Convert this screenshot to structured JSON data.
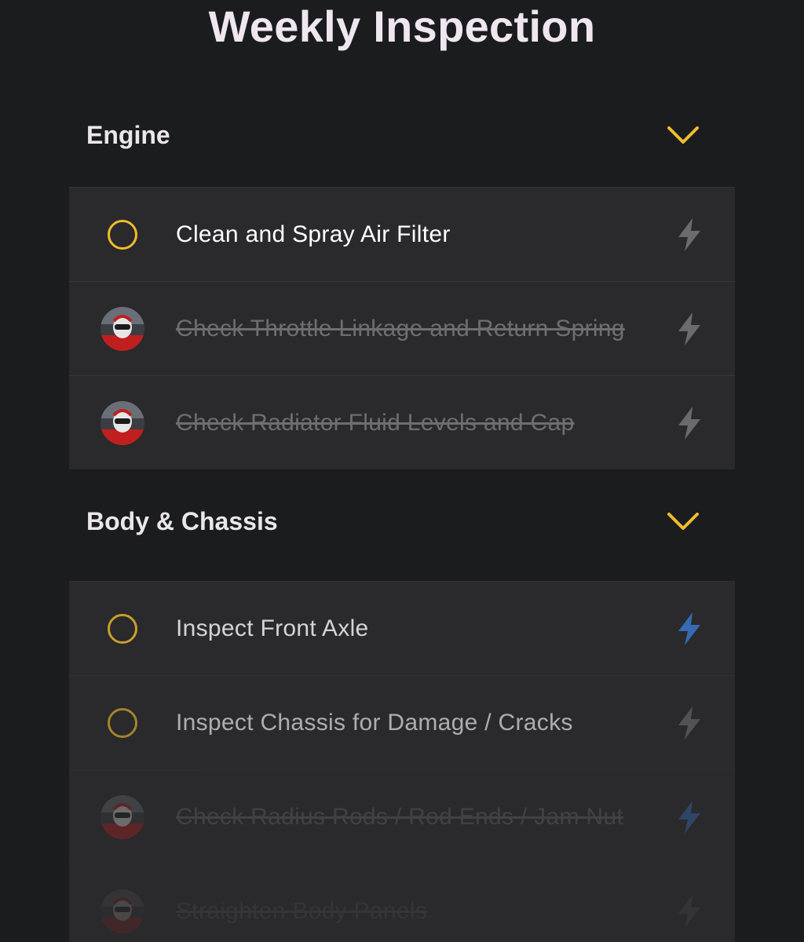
{
  "page": {
    "title": "Weekly Inspection"
  },
  "colors": {
    "accent": "#f1bd2e",
    "bolt_default": "#6b6b6e",
    "bolt_active": "#3a7bd5",
    "background": "#1a1c1e",
    "card": "#2a292b"
  },
  "sections": [
    {
      "title": "Engine",
      "toggle_icon": "chevron-down-icon",
      "tasks": [
        {
          "label": "Clean and Spray Air Filter",
          "done": false,
          "status_icon": "empty-circle-icon",
          "action_icon": "lightning-bolt-icon",
          "bolt_active": false
        },
        {
          "label": "Check Throttle Linkage and Return Spring",
          "done": true,
          "status_icon": "user-avatar",
          "action_icon": "lightning-bolt-icon",
          "bolt_active": false
        },
        {
          "label": "Check Radiator Fluid Levels and Cap",
          "done": true,
          "status_icon": "user-avatar",
          "action_icon": "lightning-bolt-icon",
          "bolt_active": false
        }
      ]
    },
    {
      "title": "Body & Chassis",
      "toggle_icon": "chevron-down-icon",
      "tasks": [
        {
          "label": "Inspect Front Axle",
          "done": false,
          "status_icon": "empty-circle-icon",
          "action_icon": "lightning-bolt-icon",
          "bolt_active": true
        },
        {
          "label": "Inspect Chassis for Damage / Cracks",
          "done": false,
          "status_icon": "empty-circle-icon",
          "action_icon": "lightning-bolt-icon",
          "bolt_active": false
        },
        {
          "label": "Check Radius Rods / Rod Ends / Jam Nut",
          "done": true,
          "status_icon": "user-avatar",
          "action_icon": "lightning-bolt-icon",
          "bolt_active": true
        },
        {
          "label": "Straighten Body Panels",
          "done": true,
          "status_icon": "user-avatar",
          "action_icon": "lightning-bolt-icon",
          "bolt_active": false
        }
      ]
    }
  ]
}
